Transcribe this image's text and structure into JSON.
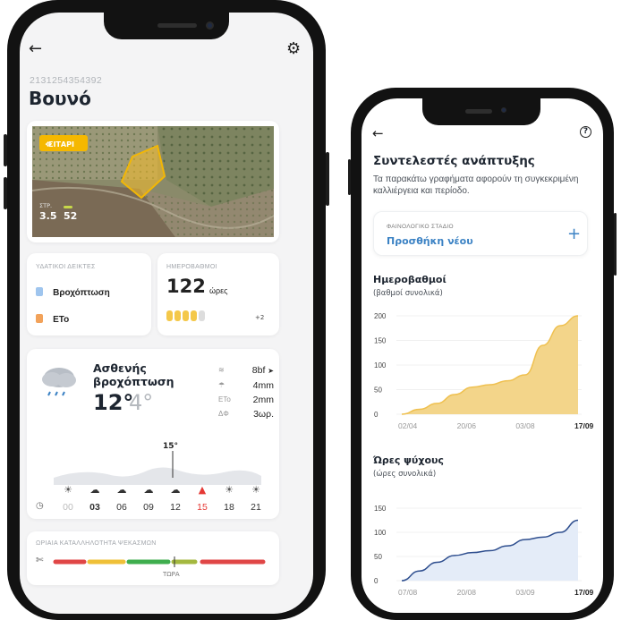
{
  "left_screen": {
    "field_id": "2131254354392",
    "field_name": "Βουνό",
    "map": {
      "crop_badge": "ΣΙΤΑΡΙ",
      "area_label": "ΣΤΡ.",
      "area_value": "3.5",
      "second_value": "52"
    },
    "water_card": {
      "title": "ΥΔΑΤΙΚΟΙ ΔΕΙΚΤΕΣ",
      "items": [
        "Βροχόπτωση",
        "ETo"
      ]
    },
    "degree_days_card": {
      "title": "ΗΜΕΡΟΒΑΘΜΟΙ",
      "value": "122",
      "unit": "ώρες",
      "extra": "+2"
    },
    "weather": {
      "condition": "Ασθενής βροχόπτωση",
      "temp_high": "12°",
      "temp_low": "4°",
      "stats": [
        {
          "icon": "wind-icon",
          "glyph": "≋",
          "value": "8bf"
        },
        {
          "icon": "rain-drop-icon",
          "glyph": "☂",
          "value": "4mm"
        },
        {
          "icon": "eto-icon",
          "glyph": "ETo",
          "value": "2mm"
        },
        {
          "icon": "delta-phi-icon",
          "glyph": "ΔΦ",
          "value": "3ωρ."
        }
      ],
      "peak_temp": "15°",
      "hours": [
        "00",
        "03",
        "06",
        "09",
        "12",
        "15",
        "18",
        "21"
      ],
      "current_hour_index": 1,
      "alert_hour_index": 5
    },
    "spray": {
      "title": "ΩΡΙΑΙΑ ΚΑΤΑΛΛΗΛΟΤΗΤΑ ΨΕΚΑΣΜΩΝ",
      "now_label": "ΤΩΡΑ"
    }
  },
  "right_screen": {
    "title": "Συντελεστές ανάπτυξης",
    "subtitle": "Τα παρακάτω γραφήματα αφορούν τη συγκεκριμένη καλλιέργεια και περίοδο.",
    "phase_card": {
      "label": "ΦΑΙΝΟΛΟΓΙΚΟ ΣΤΑΔΙΟ",
      "action": "Προσθήκη νέου",
      "plus": "+"
    }
  },
  "colors": {
    "accent_blue": "#3b82c4",
    "area_yellow": "#f3d58a",
    "line_yellow": "#efc04f",
    "area_blue": "#e4ecf8",
    "line_blue": "#2f4f8f",
    "alert_red": "#e53935"
  },
  "chart_data": [
    {
      "type": "area",
      "title": "Ημεροβαθμοί",
      "subtitle": "(βαθμοί συνολικά)",
      "x": [
        "02/04",
        "20/06",
        "03/08",
        "17/09"
      ],
      "y_ticks": [
        200,
        150,
        100,
        50,
        0
      ],
      "ylim": [
        0,
        200
      ],
      "values": [
        0,
        10,
        22,
        40,
        55,
        60,
        68,
        80,
        140,
        180,
        200
      ],
      "grid": true
    },
    {
      "type": "line",
      "title": "Ώρες ψύχους",
      "subtitle": "(ώρες συνολικά)",
      "x": [
        "07/08",
        "20/08",
        "03/09",
        "17/09"
      ],
      "y_ticks": [
        150,
        100,
        50,
        0
      ],
      "ylim": [
        0,
        150
      ],
      "values": [
        0,
        20,
        38,
        52,
        58,
        62,
        72,
        85,
        90,
        100,
        125
      ],
      "grid": true
    }
  ]
}
